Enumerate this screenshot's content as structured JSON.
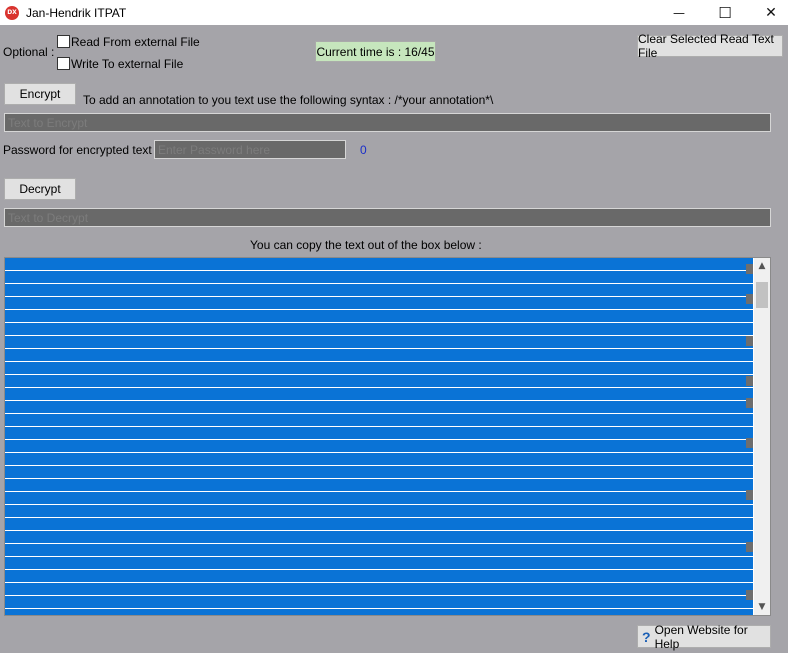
{
  "window": {
    "icon_text": "DX",
    "title": "Jan-Hendrik ITPAT",
    "minimize": "—",
    "maximize": "☐",
    "close": "✕"
  },
  "options": {
    "label": "Optional :",
    "read_external": "Read From external File",
    "write_external": "Write To external File",
    "current_time": "Current time is : 16/45",
    "clear_button": "Clear Selected Read Text File"
  },
  "encrypt": {
    "button": "Encrypt",
    "hint": "To add an annotation to you text use the following syntax : /*your annotation*\\",
    "placeholder": "Text to Encrypt"
  },
  "password": {
    "label": "Password for encrypted text :",
    "placeholder": "Enter Password here",
    "count": "0"
  },
  "decrypt": {
    "button": "Decrypt",
    "placeholder": "Text to Decrypt"
  },
  "output": {
    "label": "You can copy the text out of the box below :"
  },
  "help": {
    "icon": "?",
    "button": "Open Website for Help"
  }
}
